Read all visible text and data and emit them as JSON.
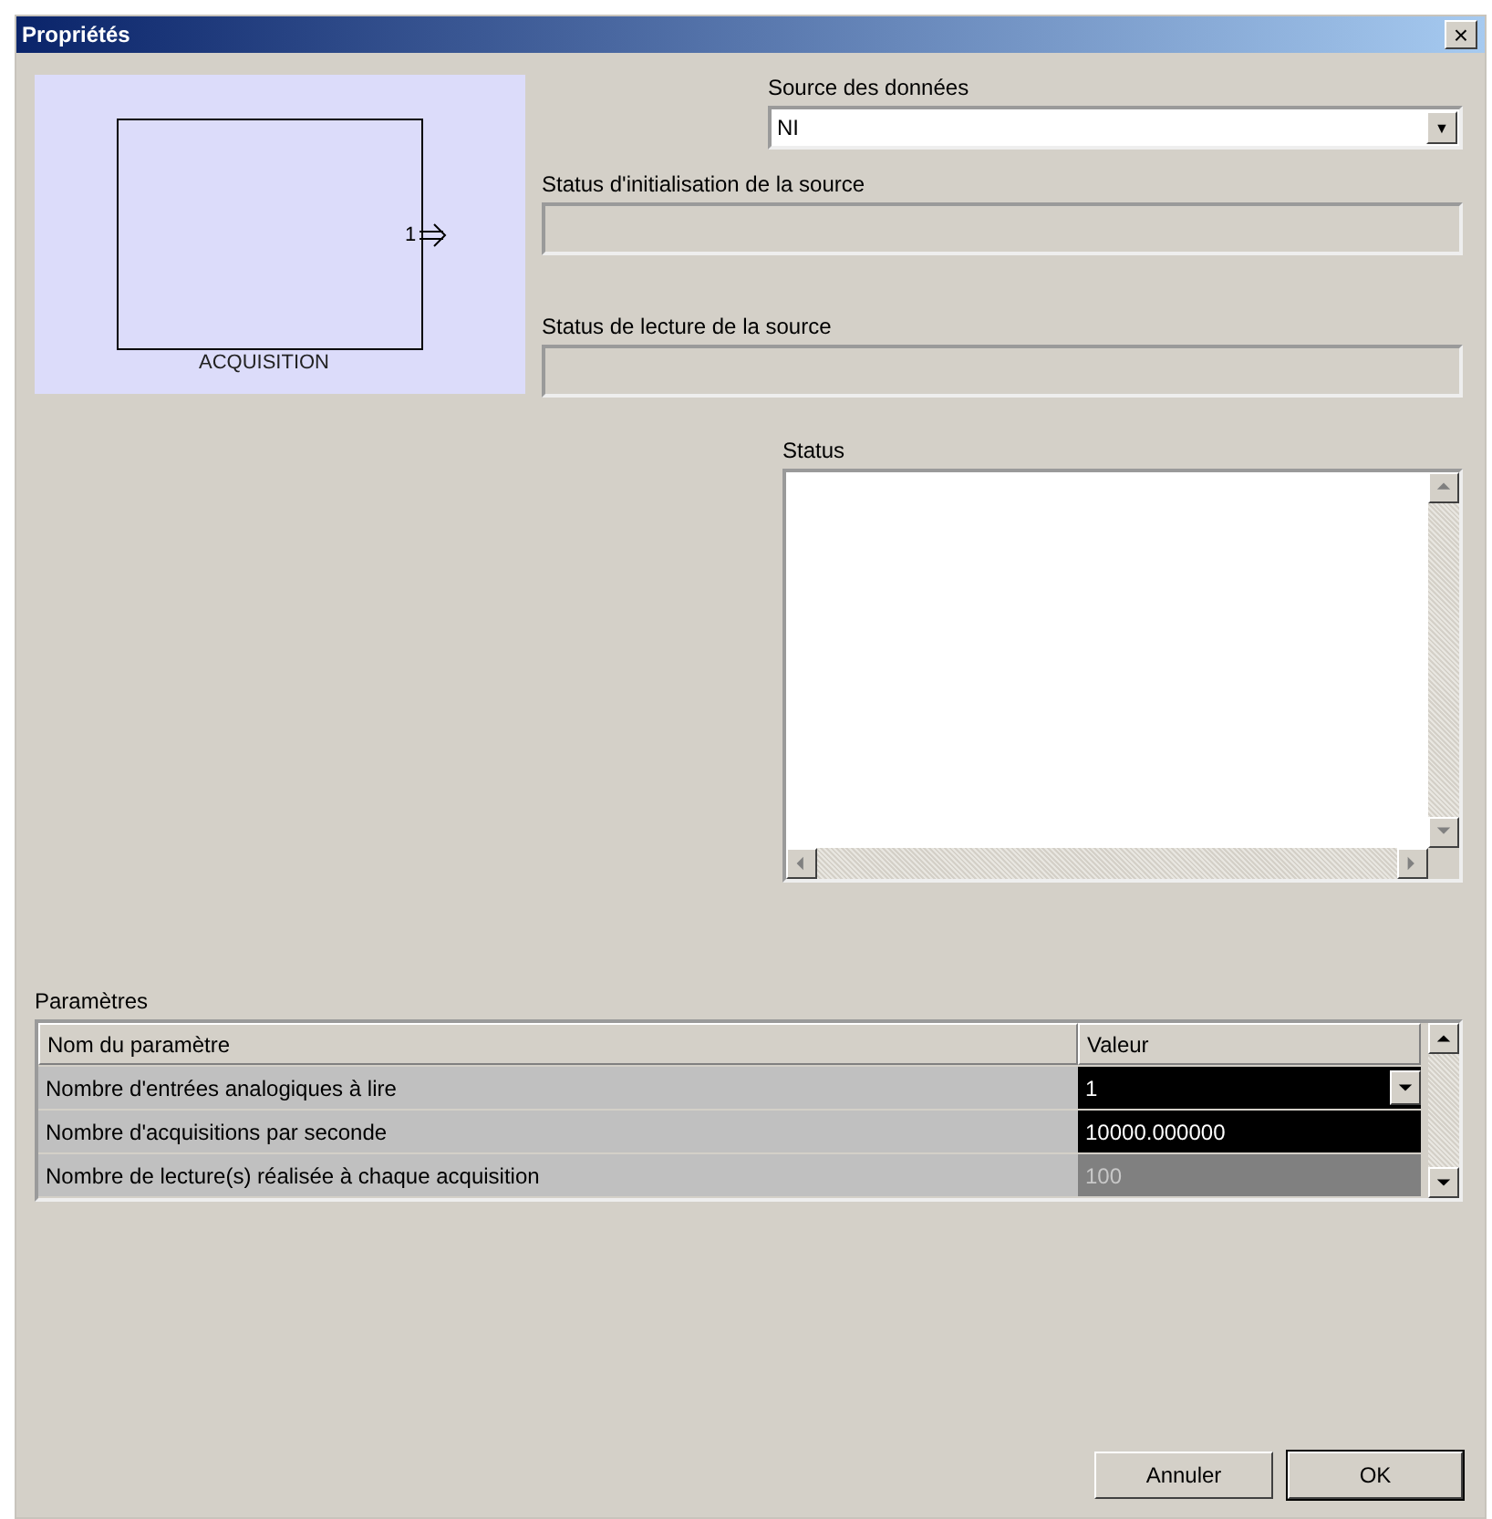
{
  "window": {
    "title": "Propriétés",
    "close": "×"
  },
  "preview": {
    "block_label": "ACQUISITION",
    "port_label": "1"
  },
  "source": {
    "label": "Source des données",
    "value": "NI",
    "arrow": "▼"
  },
  "init_status": {
    "label": "Status d'initialisation de la source"
  },
  "read_status": {
    "label": "Status de lecture de la source"
  },
  "status": {
    "label": "Status"
  },
  "parameters": {
    "label": "Paramètres",
    "columns": [
      "Nom du paramètre",
      "Valeur"
    ],
    "rows": [
      {
        "name": "Nombre d'entrées analogiques à lire",
        "value": "1",
        "kind": "dropdown",
        "disabled": false
      },
      {
        "name": "Nombre d'acquisitions par seconde",
        "value": "10000.000000",
        "kind": "text",
        "disabled": false
      },
      {
        "name": "Nombre de lecture(s) réalisée à chaque acquisition",
        "value": "100",
        "kind": "text",
        "disabled": true
      }
    ]
  },
  "buttons": [
    "Annuler",
    "OK"
  ]
}
